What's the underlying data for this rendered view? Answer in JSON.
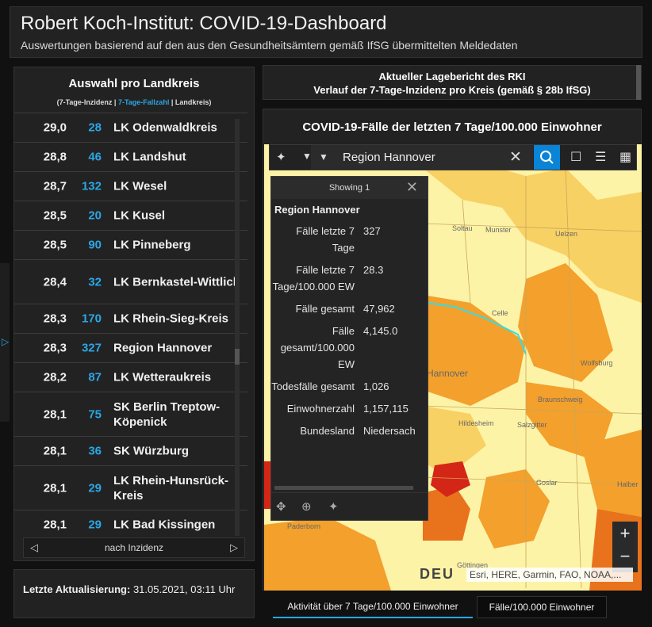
{
  "header": {
    "title": "Robert Koch-Institut: COVID-19-Dashboard",
    "subtitle": "Auswertungen basierend auf den aus den Gesundheitsämtern gemäß IfSG übermittelten Meldedaten"
  },
  "list_panel": {
    "title": "Auswahl pro Landkreis",
    "legend_incidence": "(7-Tage-Inzidenz |",
    "legend_cases": "7-Tage-Fallzahl",
    "legend_district": "| Landkreis)",
    "rows": [
      {
        "incidence": "29,0",
        "cases": "28",
        "name": "LK Odenwaldkreis"
      },
      {
        "incidence": "28,8",
        "cases": "46",
        "name": "LK Landshut"
      },
      {
        "incidence": "28,7",
        "cases": "132",
        "name": "LK Wesel"
      },
      {
        "incidence": "28,5",
        "cases": "20",
        "name": "LK Kusel"
      },
      {
        "incidence": "28,5",
        "cases": "90",
        "name": "LK Pinneberg"
      },
      {
        "incidence": "28,4",
        "cases": "32",
        "name": "LK Bernkastel-Wittlich"
      },
      {
        "incidence": "28,3",
        "cases": "170",
        "name": "LK Rhein-Sieg-Kreis"
      },
      {
        "incidence": "28,3",
        "cases": "327",
        "name": "Region Hannover"
      },
      {
        "incidence": "28,2",
        "cases": "87",
        "name": "LK Wetteraukreis"
      },
      {
        "incidence": "28,1",
        "cases": "75",
        "name": "SK Berlin Treptow-Köpenick"
      },
      {
        "incidence": "28,1",
        "cases": "36",
        "name": "SK Würzburg"
      },
      {
        "incidence": "28,1",
        "cases": "29",
        "name": "LK Rhein-Hunsrück-Kreis"
      },
      {
        "incidence": "28,1",
        "cases": "29",
        "name": "LK Bad Kissingen"
      }
    ],
    "pager_label": "nach Inzidenz"
  },
  "update": {
    "label": "Letzte Aktualisierung:",
    "value": "31.05.2021, 03:11 Uhr"
  },
  "report": {
    "line1": "Aktueller Lagebericht des RKI",
    "line2": "Verlauf der 7-Tage-Inzidenz pro Kreis (gemäß § 28b IfSG)"
  },
  "map": {
    "title": "COVID-19-Fälle der letzten 7 Tage/100.000 Einwohner",
    "search_value": "Region Hannover",
    "popup": {
      "showing": "Showing 1",
      "title": "Region Hannover",
      "fields": [
        {
          "key": "Fälle letzte 7 Tage",
          "value": "327"
        },
        {
          "key": "Fälle letzte 7 Tage/100.000 EW",
          "value": "28.3"
        },
        {
          "key": "Fälle gesamt",
          "value": "47,962"
        },
        {
          "key": "Fälle gesamt/100.000 EW",
          "value": "4,145.0"
        },
        {
          "key": "Todesfälle gesamt",
          "value": "1,026"
        },
        {
          "key": "Einwohnerzahl",
          "value": "1,157,115"
        },
        {
          "key": "Bundesland",
          "value": "Niedersach"
        }
      ]
    },
    "cities": {
      "soltau": "Soltau",
      "munster": "Munster",
      "uelzen": "Uelzen",
      "celle": "Celle",
      "hannover": "Hannover",
      "wolfsburg": "Wolfsburg",
      "braunschweig": "Braunschweig",
      "hildesheim": "Hildesheim",
      "salzgitter": "Salzgitter",
      "goslar": "Goslar",
      "paderborn": "Paderborn",
      "gottingen": "Göttingen",
      "halber": "Halber"
    },
    "watermark": "DEU",
    "attribution": "Esri, HERE, Garmin, FAO, NOAA,...",
    "zoom_in": "+",
    "zoom_out": "−"
  },
  "tabs": [
    {
      "label": "Aktivität über 7 Tage/100.000 Einwohner"
    },
    {
      "label": "Fälle/100.000 Einwohner"
    }
  ],
  "colors": {
    "accent": "#2aa7e6",
    "search_button": "#0a84d6",
    "map_light": "#fdf3a7",
    "map_mid": "#f8d164",
    "map_orange": "#f3a02d",
    "map_dark_orange": "#e8731c",
    "map_red": "#d42616"
  },
  "icons": {
    "select": "select-feature-icon",
    "search": "search-icon",
    "bookmark": "bookmark-icon",
    "list": "list-icon",
    "qr": "qr-code-icon",
    "close": "close-icon",
    "pan": "pan-icon",
    "zoom_to": "zoom-to-icon"
  }
}
